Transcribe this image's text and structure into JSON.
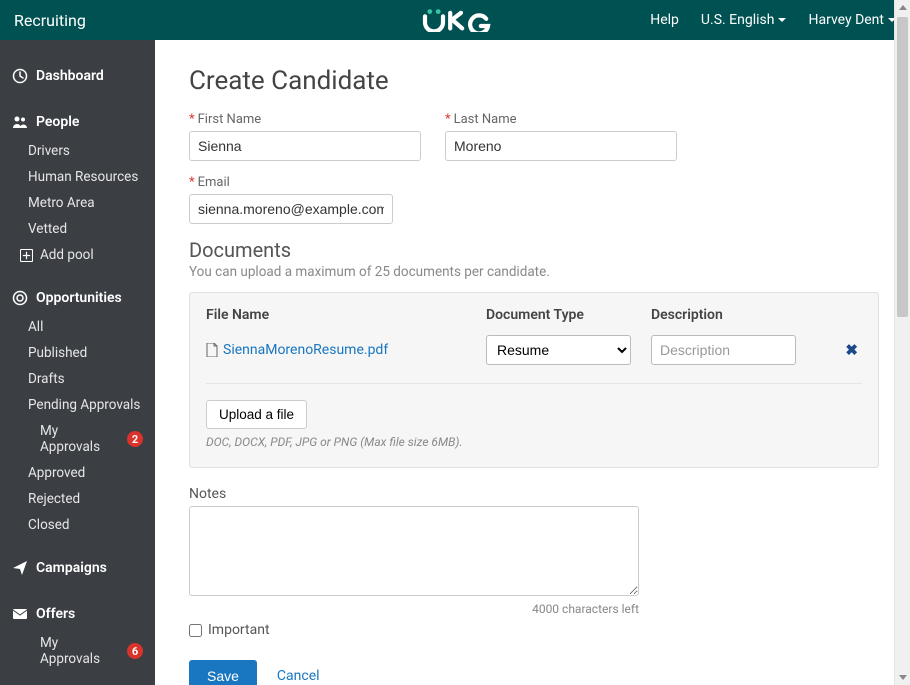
{
  "topbar": {
    "app_title": "Recruiting",
    "help": "Help",
    "language": "U.S. English",
    "user": "Harvey Dent"
  },
  "sidebar": {
    "dashboard": "Dashboard",
    "people": {
      "label": "People",
      "items": [
        "Drivers",
        "Human Resources",
        "Metro Area",
        "Vetted"
      ],
      "add_pool": "Add pool"
    },
    "opportunities": {
      "label": "Opportunities",
      "items": [
        {
          "label": "All",
          "badge": null
        },
        {
          "label": "Published",
          "badge": null
        },
        {
          "label": "Drafts",
          "badge": null
        },
        {
          "label": "Pending Approvals",
          "badge": null
        },
        {
          "label": "My Approvals",
          "badge": "2",
          "sub": true
        },
        {
          "label": "Approved",
          "badge": null
        },
        {
          "label": "Rejected",
          "badge": null
        },
        {
          "label": "Closed",
          "badge": null
        }
      ]
    },
    "campaigns": {
      "label": "Campaigns"
    },
    "offers": {
      "label": "Offers",
      "items": [
        {
          "label": "My Approvals",
          "badge": "6",
          "sub": true
        }
      ]
    }
  },
  "page": {
    "title": "Create Candidate",
    "first_name_label": "First Name",
    "first_name_value": "Sienna",
    "last_name_label": "Last Name",
    "last_name_value": "Moreno",
    "email_label": "Email",
    "email_value": "sienna.moreno@example.com",
    "documents": {
      "title": "Documents",
      "subtitle": "You can upload a maximum of 25 documents per candidate.",
      "col_file": "File Name",
      "col_type": "Document Type",
      "col_desc": "Description",
      "file_name": "SiennaMorenoResume.pdf",
      "type_options": [
        "Resume"
      ],
      "type_selected": "Resume",
      "desc_placeholder": "Description",
      "upload_label": "Upload a file",
      "upload_hint": "DOC, DOCX, PDF, JPG or PNG (Max file size 6MB)."
    },
    "notes": {
      "label": "Notes",
      "chars_left": "4000 characters left",
      "important": "Important"
    },
    "actions": {
      "save": "Save",
      "cancel": "Cancel"
    }
  }
}
